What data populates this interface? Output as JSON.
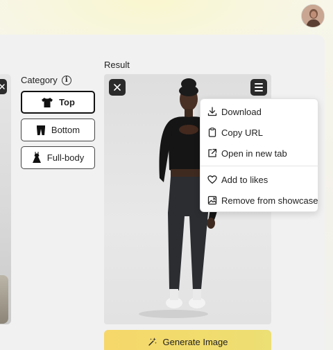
{
  "category": {
    "label": "Category",
    "options": [
      {
        "label": "Top",
        "icon": "tshirt-icon",
        "selected": true
      },
      {
        "label": "Bottom",
        "icon": "pants-icon",
        "selected": false
      },
      {
        "label": "Full-body",
        "icon": "dress-icon",
        "selected": false
      }
    ]
  },
  "result": {
    "label": "Result"
  },
  "menu": {
    "items": [
      {
        "label": "Download",
        "icon": "download-icon"
      },
      {
        "label": "Copy URL",
        "icon": "clipboard-icon"
      },
      {
        "label": "Open in new tab",
        "icon": "external-link-icon"
      },
      {
        "label": "Add to likes",
        "icon": "heart-icon"
      },
      {
        "label": "Remove from showcase",
        "icon": "image-remove-icon"
      }
    ]
  },
  "generate_button": {
    "label": "Generate Image",
    "icon": "sparkles-icon"
  },
  "colors": {
    "accent_yellow": "#f2d96c",
    "dark_button": "#2a2a2a"
  }
}
